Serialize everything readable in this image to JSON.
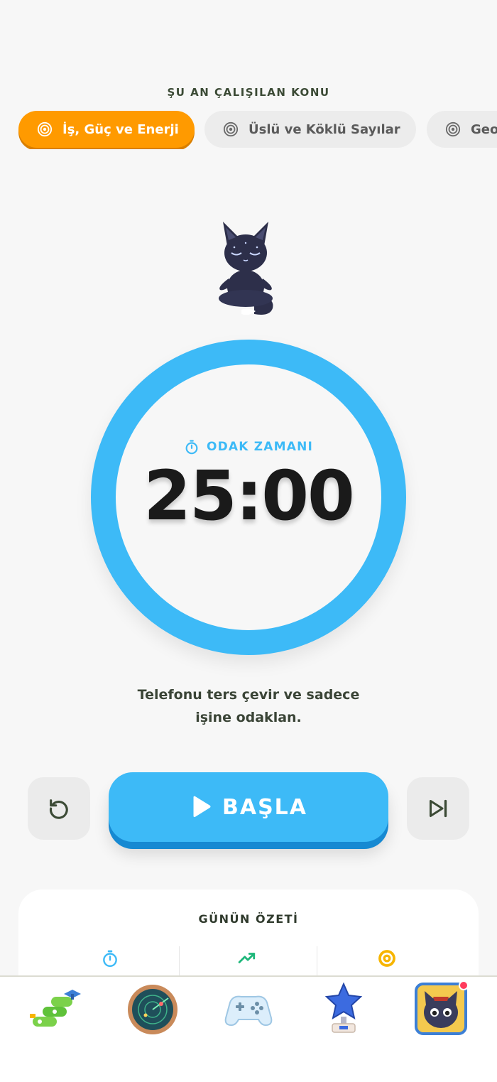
{
  "header": {
    "section_label": "ŞU AN ÇALIŞILAN KONU"
  },
  "topics": [
    {
      "label": "İş, Güç ve Enerji",
      "active": true
    },
    {
      "label": "Üslü ve Köklü Sayılar",
      "active": false
    },
    {
      "label": "Geometri",
      "active": false
    }
  ],
  "timer": {
    "mode_label": "ODAK ZAMANI",
    "value": "25:00",
    "hint_line1": "Telefonu ters çevir ve sadece",
    "hint_line2": "işine odaklan."
  },
  "controls": {
    "start_label": "BAŞLA"
  },
  "summary": {
    "title": "GÜNÜN ÖZETİ"
  },
  "colors": {
    "accent_blue": "#3dbaf7",
    "accent_orange": "#ff9a00",
    "stat_green": "#1db77a"
  }
}
